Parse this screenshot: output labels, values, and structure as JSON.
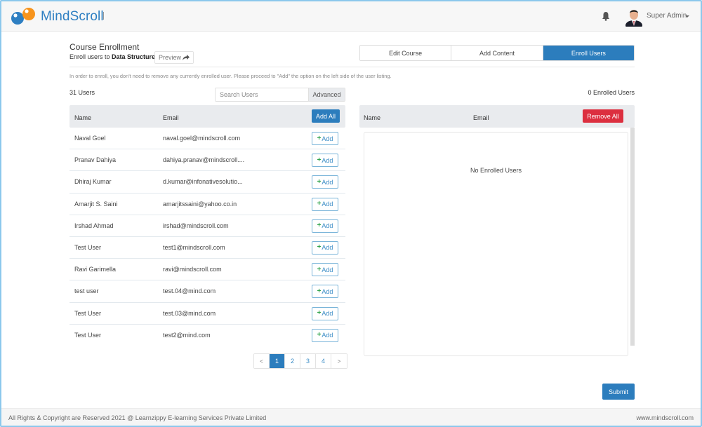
{
  "header": {
    "brand": "MindScroll",
    "user_name": "Super Admin",
    "icons": {
      "logo": "mindscroll-logo",
      "notifications": "bell-icon",
      "avatar": "user-avatar",
      "menu": "caret-down-icon"
    }
  },
  "course": {
    "title": "Course Enrollment",
    "enroll_prefix": "Enroll users to",
    "course_name": "Data Structure",
    "preview_label": "Preview",
    "preview_icon": "share-arrow-icon"
  },
  "tabs": [
    {
      "label": "Edit Course",
      "active": false
    },
    {
      "label": "Add Content",
      "active": false
    },
    {
      "label": "Enroll Users",
      "active": true
    }
  ],
  "info_text": "In order to enroll, you don't need to remove any currently enrolled user. Please proceed to \"Add\" the option on the left side of the user listing.",
  "users_panel": {
    "count_label": "31 Users",
    "search_placeholder": "Search Users",
    "search_value": "",
    "advanced_label": "Advanced",
    "columns": {
      "name": "Name",
      "email": "Email"
    },
    "add_all_label": "Add All",
    "add_label": "Add",
    "rows": [
      {
        "name": "Naval Goel",
        "email": "naval.goel@mindscroll.com"
      },
      {
        "name": "Pranav Dahiya",
        "email": "dahiya.pranav@mindscroll...."
      },
      {
        "name": "Dhiraj Kumar",
        "email": "d.kumar@infonativesolutio..."
      },
      {
        "name": "Amarjit S. Saini",
        "email": "amarjitssaini@yahoo.co.in"
      },
      {
        "name": "Irshad Ahmad",
        "email": "irshad@mindscroll.com"
      },
      {
        "name": "Test User",
        "email": "test1@mindscroll.com"
      },
      {
        "name": "Ravi Garimella",
        "email": "ravi@mindscroll.com"
      },
      {
        "name": "test user",
        "email": "test.04@mind.com"
      },
      {
        "name": "Test User",
        "email": "test.03@mind.com"
      },
      {
        "name": "Test User",
        "email": "test2@mind.com"
      }
    ],
    "pagination": {
      "prev": "<",
      "next": ">",
      "pages": [
        "1",
        "2",
        "3",
        "4"
      ],
      "current": "1"
    }
  },
  "enrolled_panel": {
    "count_label": "0 Enrolled Users",
    "columns": {
      "name": "Name",
      "email": "Email"
    },
    "remove_all_label": "Remove All",
    "empty_text": "No Enrolled Users"
  },
  "submit_label": "Submit",
  "footer": {
    "copyright": "All Rights & Copyright are Reserved 2021 @ Learnzippy E-learning Services Private Limited",
    "website": "www.mindscroll.com"
  },
  "colors": {
    "primary": "#2c7dbd",
    "danger": "#dc2f3f",
    "success": "#2fa34a",
    "brand_blue": "#2e7fc2",
    "brand_orange": "#f7941d"
  }
}
